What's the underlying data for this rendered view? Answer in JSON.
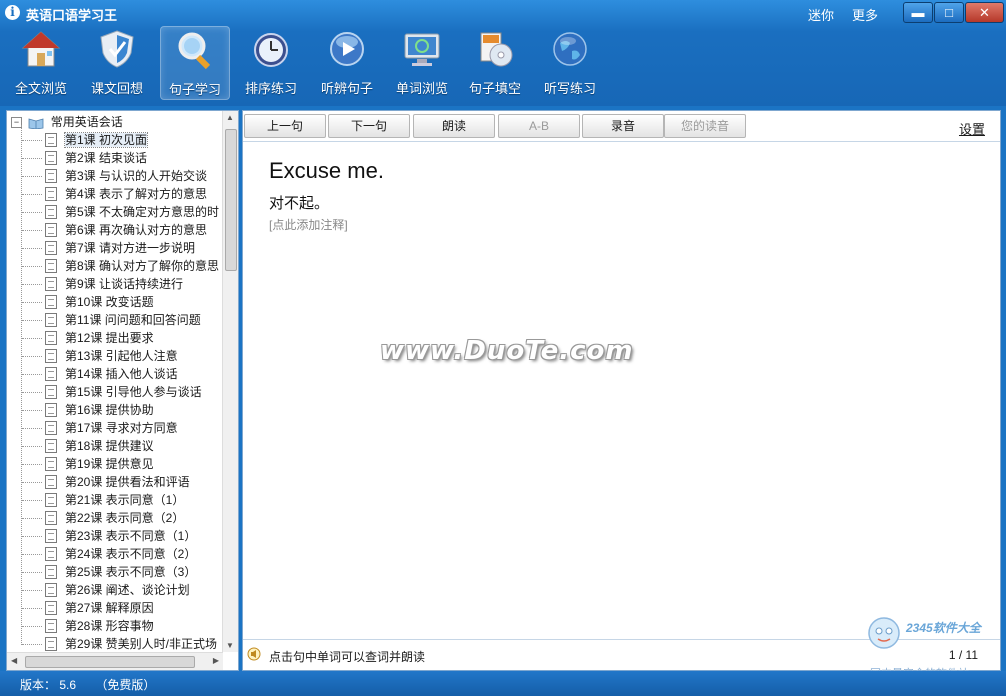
{
  "app": {
    "title": "英语口语学习王",
    "icon_glyph": "i",
    "mini_label": "迷你",
    "more_label": "更多",
    "window_buttons": {
      "minimize": "▬",
      "maximize": "□",
      "close": "✕"
    }
  },
  "toolbar": {
    "items": [
      {
        "label": "全文浏览",
        "icon": "home-icon"
      },
      {
        "label": "课文回想",
        "icon": "shield-icon"
      },
      {
        "label": "句子学习",
        "icon": "magnifier-icon"
      },
      {
        "label": "排序练习",
        "icon": "clock-icon"
      },
      {
        "label": "听辨句子",
        "icon": "play-orb-icon"
      },
      {
        "label": "单词浏览",
        "icon": "monitor-recycle-icon"
      },
      {
        "label": "句子填空",
        "icon": "disc-icon"
      },
      {
        "label": "听写练习",
        "icon": "globe-icon"
      }
    ],
    "active_index": 2
  },
  "tree": {
    "root_label": "常用英语会话",
    "expander_glyph": "−",
    "selected_index": 0,
    "items": [
      "第1课 初次见面",
      "第2课 结束谈话",
      "第3课 与认识的人开始交谈",
      "第4课 表示了解对方的意思",
      "第5课 不太确定对方意思的时",
      "第6课 再次确认对方的意思",
      "第7课 请对方进一步说明",
      "第8课 确认对方了解你的意思",
      "第9课 让谈话持续进行",
      "第10课 改变话题",
      "第11课 问问题和回答问题",
      "第12课 提出要求",
      "第13课 引起他人注意",
      "第14课 插入他人谈话",
      "第15课 引导他人参与谈话",
      "第16课 提供协助",
      "第17课 寻求对方同意",
      "第18课 提供建议",
      "第19课 提供意见",
      "第20课 提供看法和评语",
      "第21课 表示同意（1）",
      "第22课 表示同意（2）",
      "第23课 表示不同意（1）",
      "第24课 表示不同意（2）",
      "第25课 表示不同意（3）",
      "第26课 阐述、谈论计划",
      "第27课 解释原因",
      "第28课 形容事物",
      "第29课 赞美别人时/非正式场"
    ]
  },
  "player": {
    "prev": "上一句",
    "next": "下一句",
    "read": "朗读",
    "ab": "A-B",
    "record": "录音",
    "your_reading": "您的读音",
    "settings": "设置"
  },
  "sentence": {
    "english": "Excuse me.",
    "chinese": "对不起。",
    "add_note": "[点此添加注释]"
  },
  "watermark": "www.DuoTe.com",
  "footer": {
    "hint": "点击句中单词可以查词并朗读",
    "page": "1 / 11"
  },
  "stamp": {
    "brand": "2345软件大全",
    "slogan": "国内最安全的软件站"
  },
  "status": {
    "version_label": "版本：",
    "version_value": "5.6",
    "edition": "（免费版）"
  },
  "colors": {
    "chrome_blue": "#1a6fc0",
    "panel_border": "#7fa7cf"
  }
}
